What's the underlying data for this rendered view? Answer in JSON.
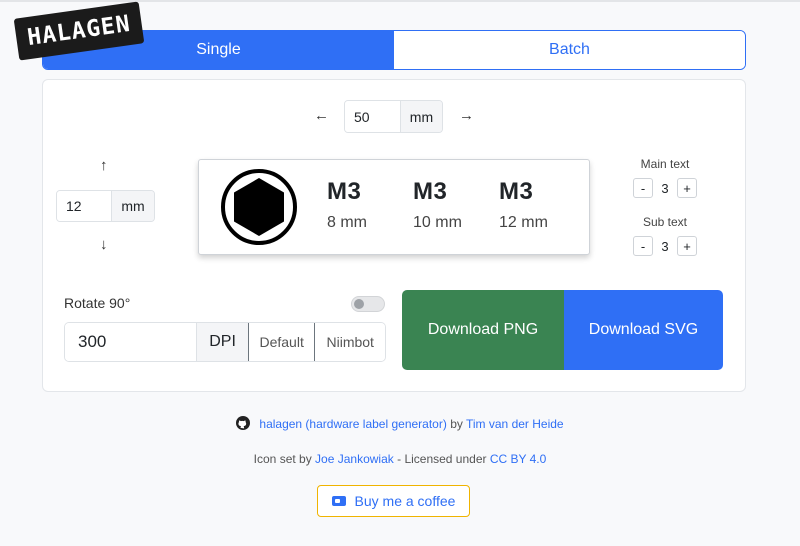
{
  "logo": {
    "text": "HALAGEN"
  },
  "tabs": [
    {
      "label": "Single",
      "active": true
    },
    {
      "label": "Batch",
      "active": false
    }
  ],
  "width_control": {
    "left_arrow": "←",
    "right_arrow": "→",
    "value": "50",
    "unit": "mm"
  },
  "height_control": {
    "up_arrow": "↑",
    "down_arrow": "↓",
    "value": "12",
    "unit": "mm"
  },
  "preview": {
    "icon": "hex-socket-icon",
    "columns": [
      {
        "main": "M3",
        "sub": "8 mm"
      },
      {
        "main": "M3",
        "sub": "10 mm"
      },
      {
        "main": "M3",
        "sub": "12 mm"
      }
    ]
  },
  "main_text": {
    "title": "Main text",
    "minus": "-",
    "value": "3",
    "plus": "+"
  },
  "sub_text": {
    "title": "Sub text",
    "minus": "-",
    "value": "3",
    "plus": "+"
  },
  "rotate": {
    "label": "Rotate 90°",
    "enabled": false
  },
  "dpi": {
    "value": "300",
    "unit": "DPI",
    "presets": [
      "Default",
      "Niimbot"
    ]
  },
  "download": {
    "png_label": "Download PNG",
    "svg_label": "Download SVG",
    "png_color": "#3a8452",
    "svg_color": "#2f6ff5"
  },
  "footer": {
    "project_link": "halagen (hardware label generator)",
    "by": "by",
    "author_link": "Tim van der Heide",
    "icon_prefix": "Icon set by",
    "icon_author": "Joe Jankowiak",
    "license_prefix": "- Licensed under",
    "license_link": "CC BY 4.0",
    "coffee_label": "Buy me a coffee"
  },
  "colors": {
    "primary": "#2f6ff5",
    "success": "#3a8452"
  }
}
